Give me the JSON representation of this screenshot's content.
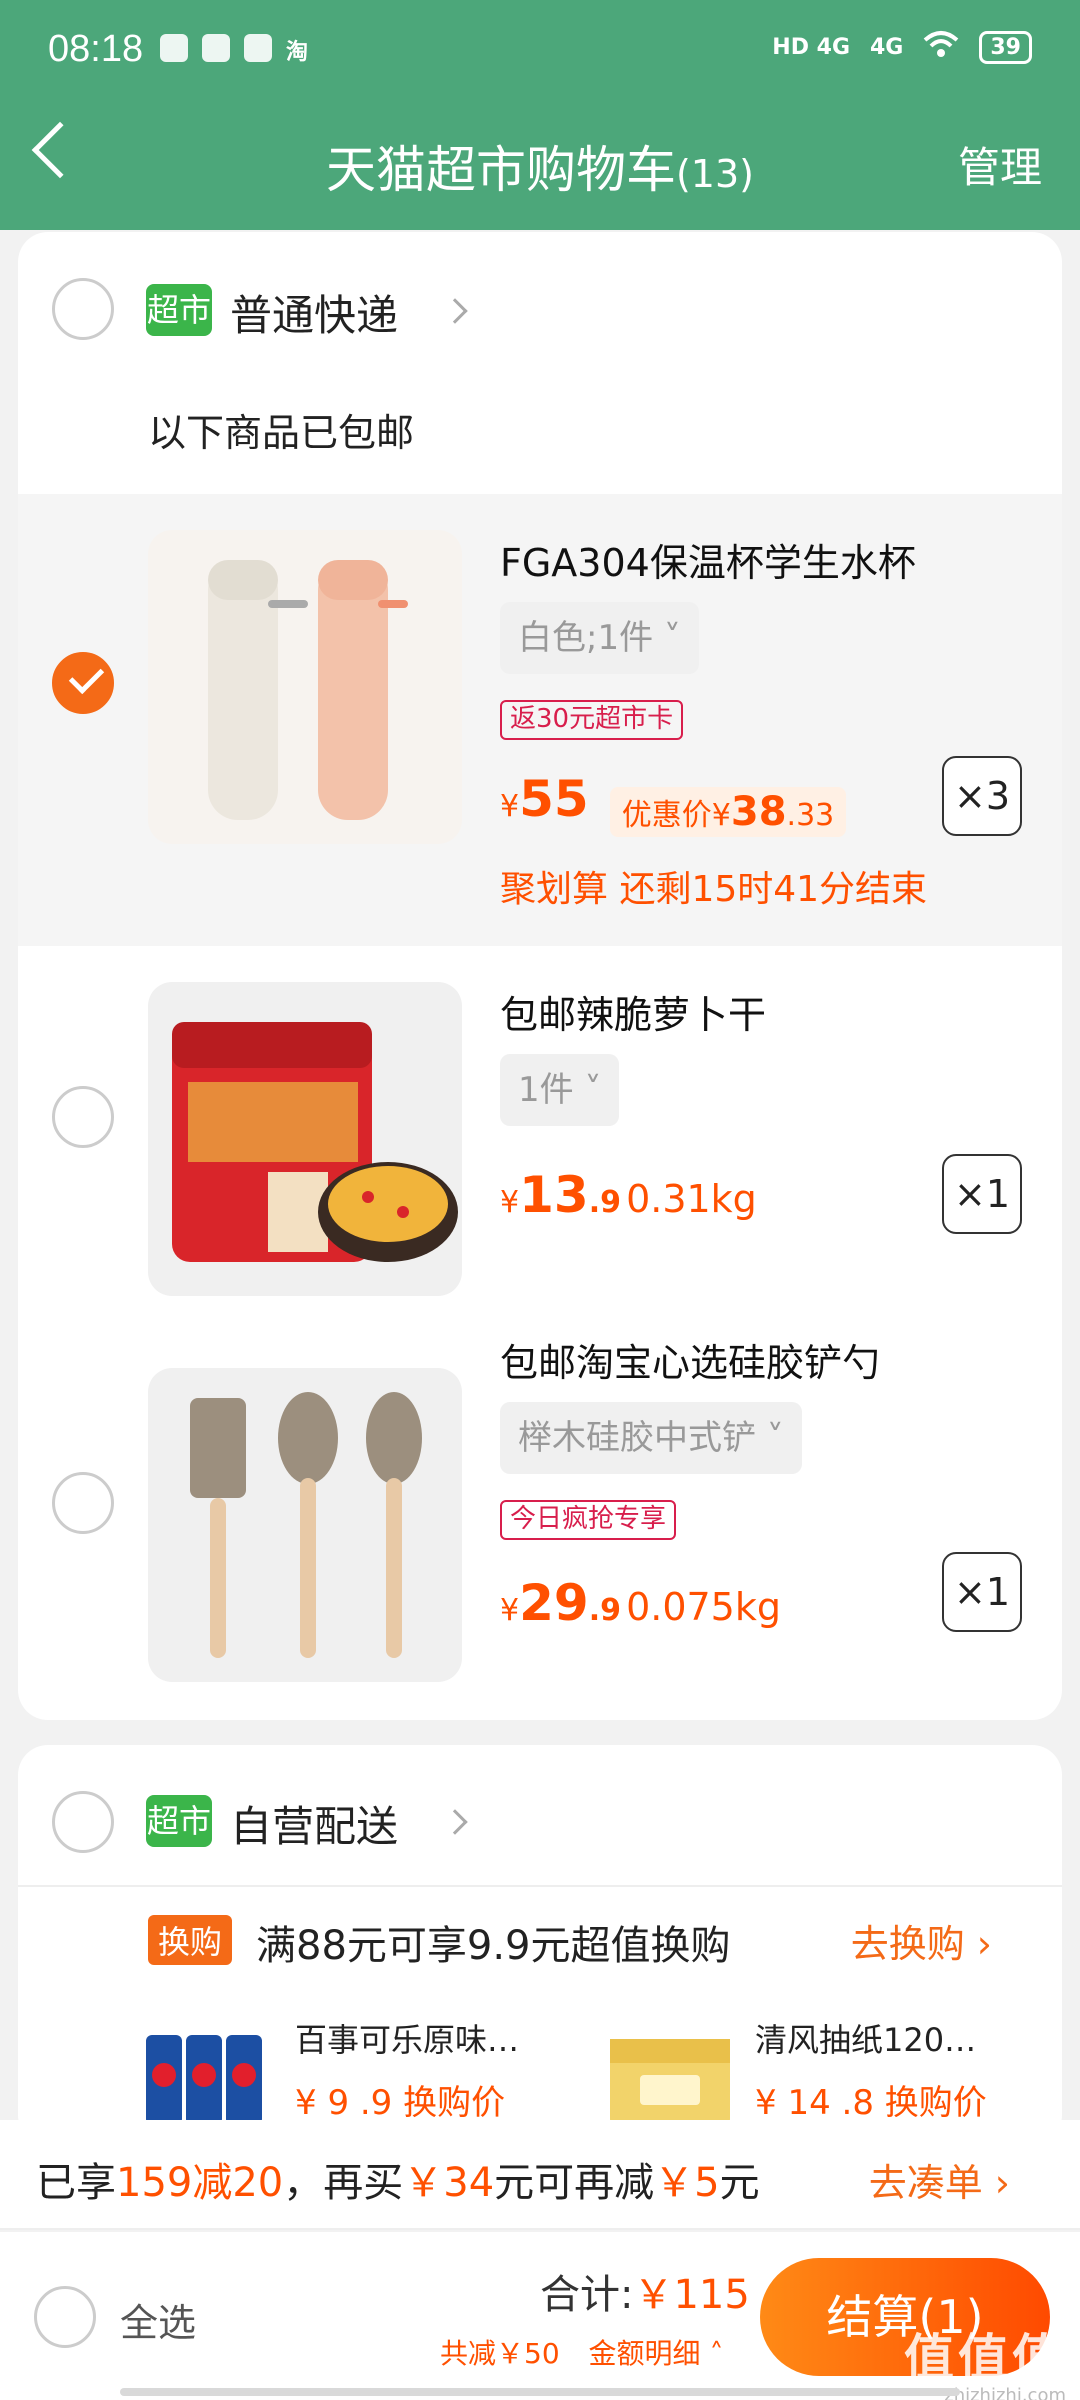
{
  "status_bar": {
    "time": "08:18",
    "network1": "HD 4G",
    "network2": "4G",
    "battery": "39"
  },
  "nav": {
    "title": "天猫超市购物车",
    "count": "(13)",
    "manage": "管理"
  },
  "colors": {
    "brand_green": "#4ca77a",
    "accent_orange": "#ff5000",
    "tag_red": "#d81e4c"
  },
  "group1": {
    "badge": "超市",
    "name": "普通快递",
    "free_shipping_note": "以下商品已包邮",
    "items": [
      {
        "title": "FGA304保温杯学生水杯",
        "sku": "白色;1件",
        "tag": "返30元超市卡",
        "currency": "¥",
        "price_int": "55",
        "price_dec": "",
        "promo_label": "优惠价¥",
        "promo_int": "38",
        "promo_dec": ".33",
        "qty": "×3",
        "deal": "聚划算 还剩15时41分结束",
        "selected": true
      },
      {
        "title": "包邮辣脆萝卜干",
        "sku": "1件",
        "currency": "¥",
        "price_int": "13",
        "price_dec": ".9",
        "weight": "0.31kg",
        "qty": "×1",
        "selected": false
      },
      {
        "title": "包邮淘宝心选硅胶铲勺",
        "sku": "榉木硅胶中式铲",
        "tag": "今日疯抢专享",
        "currency": "¥",
        "price_int": "29",
        "price_dec": ".9",
        "weight": "0.075kg",
        "qty": "×1",
        "selected": false
      }
    ]
  },
  "group2": {
    "badge": "超市",
    "name": "自营配送",
    "exchange_badge": "换购",
    "exchange_text": "满88元可享9.9元超值换购",
    "exchange_link": "去换购",
    "products": [
      {
        "name": "百事可乐原味…",
        "price": "¥ 9 .9 换购价"
      },
      {
        "name": "清风抽纸120…",
        "price": "¥ 14 .8 换购价"
      }
    ]
  },
  "promo_bar": {
    "p1": "已享",
    "h1": "159减20",
    "p2": "，再买",
    "h2": "￥34",
    "p3": "元可再减",
    "h3": "￥5",
    "p4": "元",
    "link": "去凑单"
  },
  "checkout": {
    "select_all": "全选",
    "total_label": "合计:",
    "total_amount": "￥115",
    "saved": "共减￥50",
    "detail": "金额明细",
    "button": "结算(1)",
    "watermark": "值值值",
    "watermark_site": "zhizhizhi.com"
  }
}
